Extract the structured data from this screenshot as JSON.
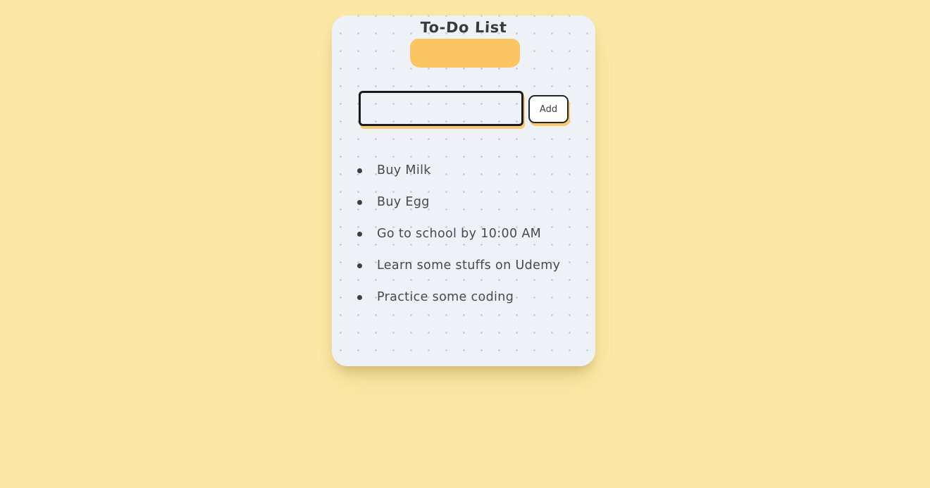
{
  "page": {
    "background_color": "#fce8a6"
  },
  "card": {
    "background_color": "#eef2f7",
    "dot_color": "#bcc3cd"
  },
  "header": {
    "title": "To-Do List",
    "badge_color": "#fbc564",
    "title_color": "#3a3a3a"
  },
  "form": {
    "input": {
      "value": "",
      "placeholder": "",
      "border_color": "#1a1a1a",
      "shadow_color": "#fbc564"
    },
    "add_button": {
      "label": "Add",
      "background_color": "#ffffff",
      "border_color": "#22262c",
      "shadow_color": "#fbc564"
    }
  },
  "tasks": {
    "bullet_color": "#3b3f46",
    "text_color": "#454a52",
    "items": [
      {
        "label": "Buy Milk"
      },
      {
        "label": "Buy Egg"
      },
      {
        "label": "Go to school by 10:00 AM"
      },
      {
        "label": "Learn some stuffs on Udemy"
      },
      {
        "label": "Practice some coding"
      }
    ]
  }
}
